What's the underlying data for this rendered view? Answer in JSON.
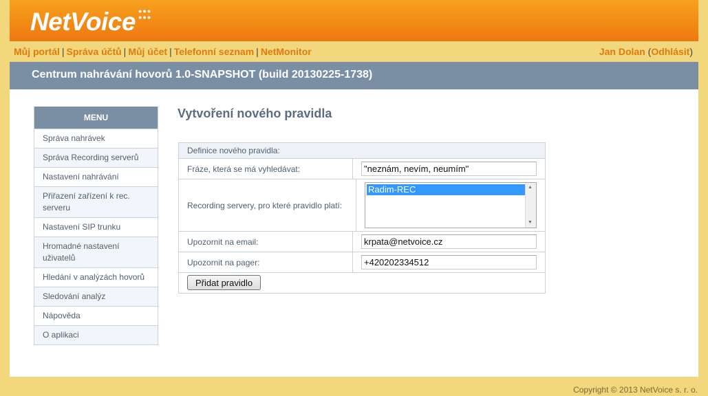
{
  "header": {
    "logo_text": "NetVoice",
    "logo_dots": "●●●\n●●●"
  },
  "nav": {
    "links": [
      "Můj portál",
      "Správa účtů",
      "Můj účet",
      "Telefonní seznam",
      "NetMonitor"
    ],
    "separator": "|",
    "user_name": "Jan Dolan",
    "logout_label": "Odhlásit"
  },
  "title_bar": "Centrum nahrávání hovorů 1.0-SNAPSHOT (build 20130225-1738)",
  "menu": {
    "heading": "MENU",
    "items": [
      "Správa nahrávek",
      "Správa Recording serverů",
      "Nastavení nahrávání",
      "Přiřazení zařízení k rec. serveru",
      "Nastavení SIP trunku",
      "Hromadné nastavení uživatelů",
      "Hledání v analýzách hovorů",
      "Sledování analýz",
      "Nápověda",
      "O aplikaci"
    ]
  },
  "content": {
    "heading": "Vytvoření nového pravidla",
    "form": {
      "caption": "Definice nového pravidla:",
      "phrase_label": "Fráze, která se má vyhledávat:",
      "phrase_value": "\"neznám, nevím, neumím\"",
      "servers_label": "Recording servery, pro které pravidlo platí:",
      "servers_options": [
        "Radim-REC"
      ],
      "email_label": "Upozornit na email:",
      "email_value": "krpata@netvoice.cz",
      "pager_label": "Upozornit na pager:",
      "pager_value": "+420202334512",
      "submit_label": "Přidat pravidlo"
    }
  },
  "footer": "Copyright © 2013 NetVoice s. r. o.",
  "colors": {
    "header_orange": "#f28b16",
    "nav_link": "#e07a10",
    "titlebar": "#7b8fa4",
    "page_border": "#f3d77c",
    "selected_option": "#3399ff"
  }
}
